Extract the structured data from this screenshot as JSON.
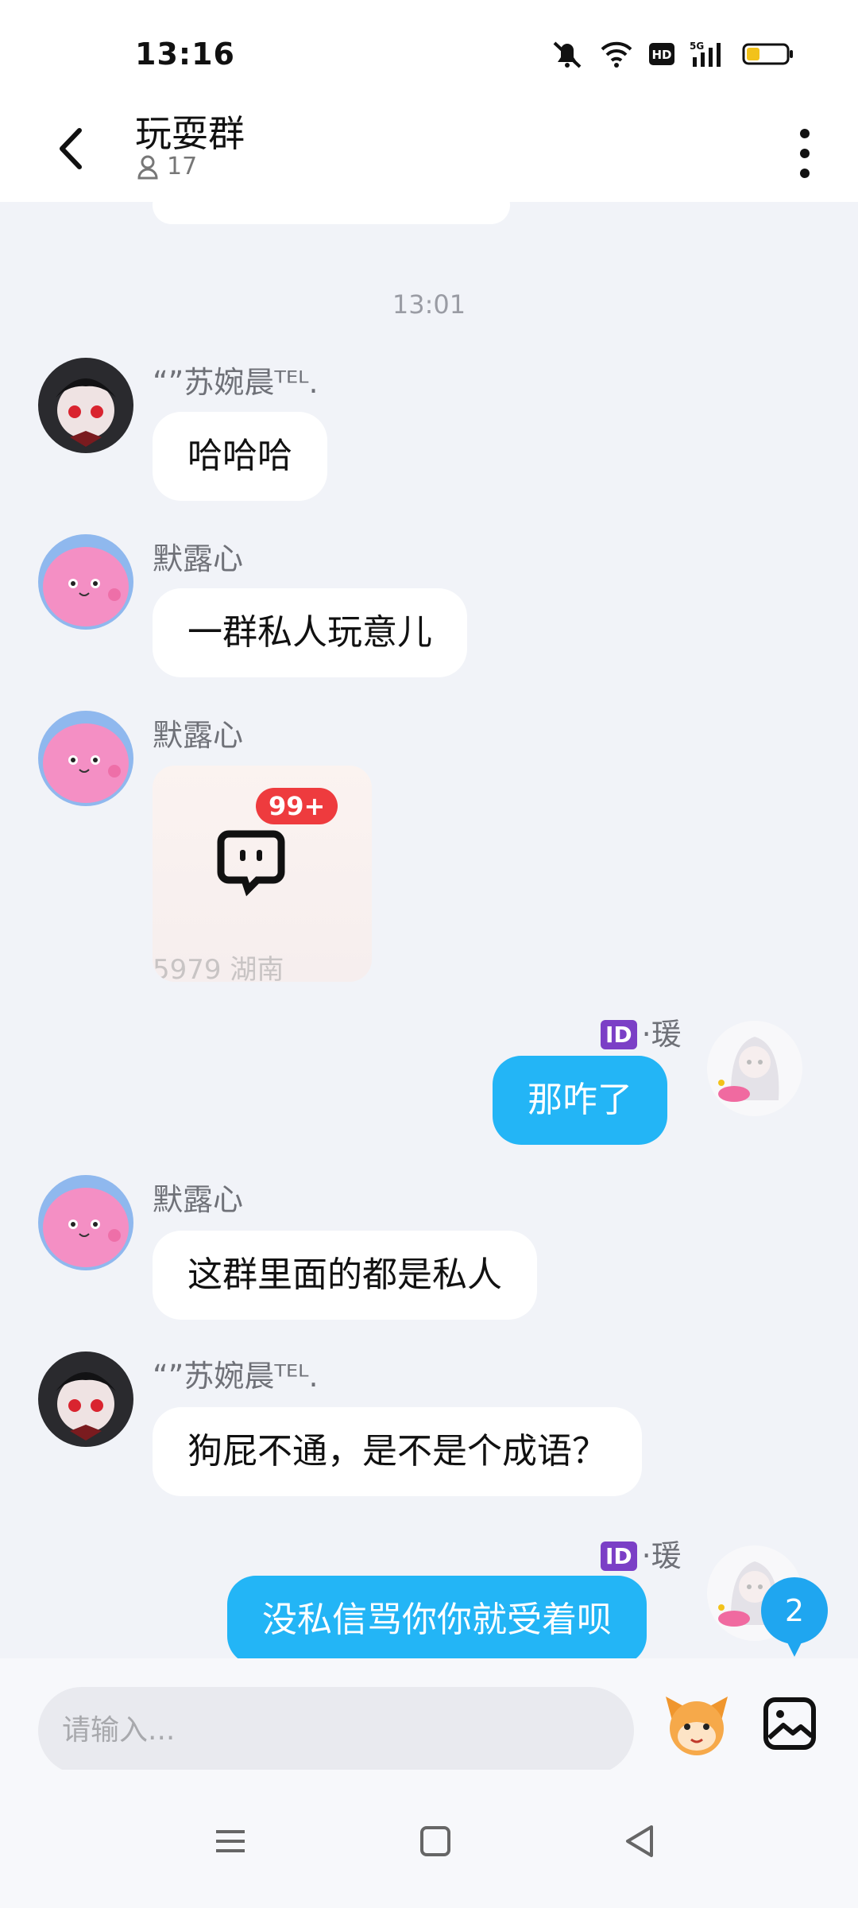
{
  "status": {
    "time": "13:16"
  },
  "header": {
    "title": "玩耍群",
    "member_count": "17"
  },
  "timestamp": "13:01",
  "messages": [
    {
      "sender": "“”苏婉晨ᵀᴱᴸ.",
      "text": "哈哈哈",
      "side": "left"
    },
    {
      "sender": "默露心",
      "text": "一群私人玩意儿",
      "side": "left"
    },
    {
      "sender": "默露心",
      "sticker_badge": "99+",
      "sticker_faint": "5979  湖南",
      "side": "left"
    },
    {
      "sender": "·瑗",
      "sender_tag": "ID",
      "text": "那咋了",
      "side": "right"
    },
    {
      "sender": "默露心",
      "text": "这群里面的都是私人",
      "side": "left"
    },
    {
      "sender": "“”苏婉晨ᵀᴱᴸ.",
      "text": "狗屁不通，是不是个成语？",
      "side": "left"
    },
    {
      "sender": "·瑗",
      "sender_tag": "ID",
      "text": "没私信骂你你就受着呗",
      "side": "right"
    }
  ],
  "unread_badge": "2",
  "composer": {
    "placeholder": "请输入..."
  },
  "colors": {
    "accent": "#23b5f6",
    "badge_red": "#ee3b3e",
    "id_tag": "#7b3fc6"
  }
}
